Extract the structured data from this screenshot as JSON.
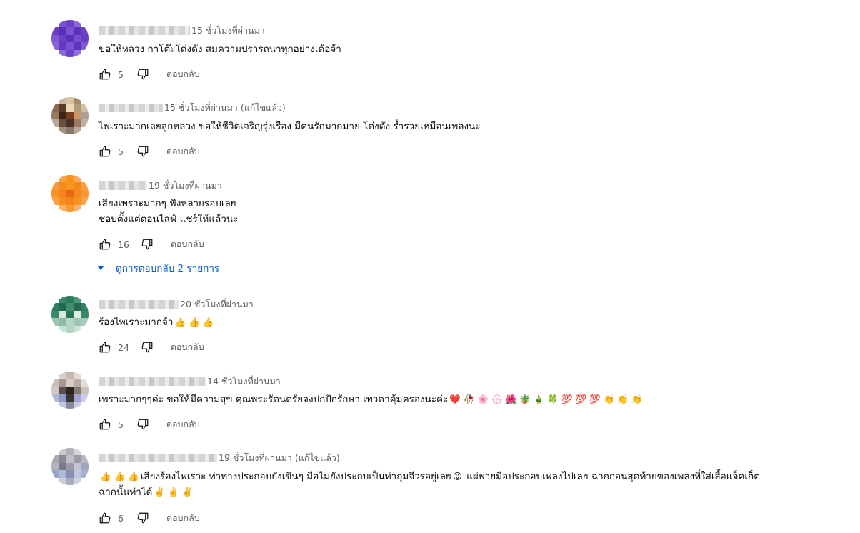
{
  "comments": [
    {
      "time": "15 ชั่วโมงที่ผ่านมา",
      "edited": "",
      "lines": [
        "ขอให้หลวง กาโต๊ะโด่งดัง สมความปรารถนาทุกอย่างเด้อจ้า"
      ],
      "likes": "5",
      "reply_label": "ตอบกลับ"
    },
    {
      "time": "15 ชั่วโมงที่ผ่านมา",
      "edited": "(แก้ไขแล้ว)",
      "lines": [
        "ไพเราะมากเลยลูกหลวง ขอให้ชีวิตเจริญรุ่งเรือง มีคนรักมากมาย โด่งดัง ร่ำรวยเหมือนเพลงนะ"
      ],
      "likes": "5",
      "reply_label": "ตอบกลับ"
    },
    {
      "time": "19 ชั่วโมงที่ผ่านมา",
      "edited": "",
      "lines": [
        "เสียงเพราะมากๆ ฟังหลายรอบเลย",
        "ชอบตั้งแต่ตอนไลฟ์ แชร์ให้แล้วนะ"
      ],
      "likes": "16",
      "reply_label": "ตอบกลับ",
      "view_replies": "ดูการตอบกลับ 2 รายการ"
    },
    {
      "time": "20 ชั่วโมงที่ผ่านมา",
      "edited": "",
      "lines": [
        "ร้องไพเราะมากจ้า"
      ],
      "emoji": [
        "👍",
        "👍",
        "👍"
      ],
      "likes": "24",
      "reply_label": "ตอบกลับ"
    },
    {
      "time": "14 ชั่วโมงที่ผ่านมา",
      "edited": "",
      "lines": [
        "เพราะมากๆๆค่ะ  ขอให้มีความสุข คุณพระรัตนตรัยจงปกปักรักษา  เทวดาคุ้มครองนะค่ะ"
      ],
      "emoji": [
        "❤️",
        "🥀",
        "🌸",
        "💮",
        "🌺",
        "🪴",
        "🎍",
        "🍀",
        "💯",
        "💯",
        "💯",
        "👏",
        "👏",
        "👏"
      ],
      "likes": "5",
      "reply_label": "ตอบกลับ"
    },
    {
      "time": "19 ชั่วโมงที่ผ่านมา",
      "edited": "(แก้ไขแล้ว)",
      "line1_emoji_prefix": [
        "👍",
        "👍",
        "👍"
      ],
      "line1_a": "เสียงร้องไพเราะ ท่าทางประกอบยังเขินๆ มือไม่ยังประกบเป็นท่ากุมจีวรอยู่เลย",
      "line1_mid_emoji": "😜",
      "line1_b": " แผ่พายมือประกอบเพลงไปเลย ฉากก่อนสุดท้ายของเพลงที่ใส่เสื้อแจ็คเก็ต",
      "line2": "ฉากนั้นท่าได้",
      "line2_emoji": [
        "✌️",
        "✌️",
        "✌️"
      ],
      "likes": "6",
      "reply_label": "ตอบกลับ"
    }
  ],
  "colors": {
    "text": "#0f0f0f",
    "secondary": "#606060",
    "link": "#065fd4"
  },
  "icons": [
    "thumbs-up-icon",
    "thumbs-down-icon",
    "caret-down-icon"
  ]
}
